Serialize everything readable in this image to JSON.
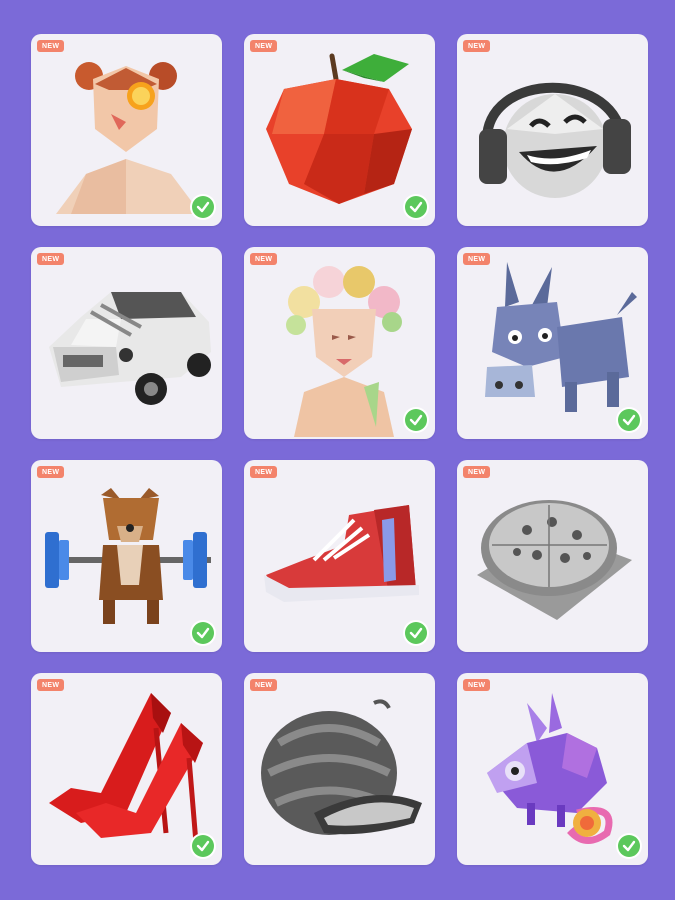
{
  "colors": {
    "background": "#7b6ad8",
    "card": "#f2f0f6",
    "badge": "#f3836b",
    "check": "#5cc85c"
  },
  "cards": [
    {
      "badge": "NEW",
      "subject": "woman with orange slice",
      "completed": true
    },
    {
      "badge": "NEW",
      "subject": "red apple",
      "completed": true
    },
    {
      "badge": "NEW",
      "subject": "laughing face with headphones",
      "completed": false
    },
    {
      "badge": "NEW",
      "subject": "white car",
      "completed": false
    },
    {
      "badge": "NEW",
      "subject": "woman with flower crown",
      "completed": true
    },
    {
      "badge": "NEW",
      "subject": "blue donkey",
      "completed": true
    },
    {
      "badge": "NEW",
      "subject": "dog lifting barbell",
      "completed": true
    },
    {
      "badge": "NEW",
      "subject": "red sneaker",
      "completed": true
    },
    {
      "badge": "NEW",
      "subject": "pizza",
      "completed": false
    },
    {
      "badge": "NEW",
      "subject": "red high heels",
      "completed": true
    },
    {
      "badge": "NEW",
      "subject": "watermelon",
      "completed": false
    },
    {
      "badge": "NEW",
      "subject": "chameleon",
      "completed": true
    }
  ]
}
